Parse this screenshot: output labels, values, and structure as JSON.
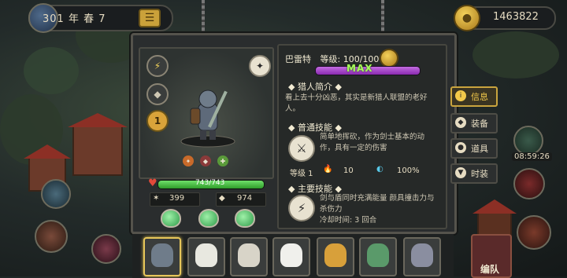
{
  "top": {
    "date": "301 年 春 7",
    "coins": "1463822"
  },
  "hero": {
    "name": "巴雷特",
    "level_label": "等级: 100/100",
    "xp_fraction": 1.0,
    "xp_label": "MAX",
    "rank": "1",
    "hp_label": "743/743",
    "hp_fraction": 1.0,
    "stat_attack": "399",
    "stat_defense": "974"
  },
  "intro": {
    "title": "猎人简介",
    "text": "看上去十分凶恶，其实是新猎人联盟的老好人。"
  },
  "normal_skill": {
    "title": "普通技能",
    "text": "简单地挥砍，作为剑士基本的动作，具有一定的伤害",
    "level_label": "等级 1",
    "fire_value": "10",
    "percent_value": "100%"
  },
  "main_skill": {
    "title": "主要技能",
    "text": "剑与盾同时充满能量 颜具撞击力与杀伤力",
    "cooldown": "冷却时间: 3 回合"
  },
  "tabs": [
    {
      "label": "信息",
      "icon": "info-icon",
      "active": true
    },
    {
      "label": "装备",
      "icon": "armor-icon",
      "active": false
    },
    {
      "label": "道具",
      "icon": "potion-icon",
      "active": false
    },
    {
      "label": "时装",
      "icon": "shirt-icon",
      "active": false
    }
  ],
  "team_label": "编队",
  "timer": "08:59:26",
  "colors": {
    "xp": "#8a2ab0",
    "hp": "#2f9c2a",
    "active_tab": "#f3c94a"
  }
}
